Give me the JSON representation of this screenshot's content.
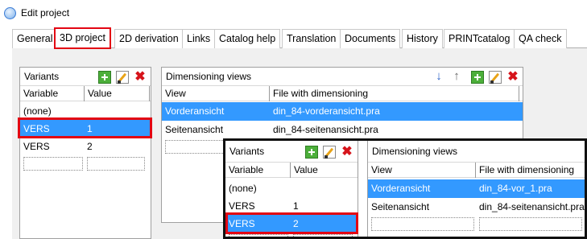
{
  "window": {
    "title": "Edit project"
  },
  "tabs": [
    {
      "label": "General"
    },
    {
      "label": "3D project"
    },
    {
      "label": "2D derivation"
    },
    {
      "label": "Links"
    },
    {
      "label": "Catalog help"
    },
    {
      "label": "Translation"
    },
    {
      "label": "Documents"
    },
    {
      "label": "History"
    },
    {
      "label": "PRINTcatalog"
    },
    {
      "label": "QA check"
    }
  ],
  "active_tab": "3D project",
  "variants": {
    "title": "Variants",
    "columns": [
      "Variable",
      "Value"
    ],
    "rows": [
      {
        "variable": "(none)",
        "value": ""
      },
      {
        "variable": "VERS",
        "value": "1"
      },
      {
        "variable": "VERS",
        "value": "2"
      }
    ],
    "selected_row": 1,
    "icons": [
      "add-icon",
      "edit-icon",
      "delete-icon"
    ]
  },
  "dimensioning_views": {
    "title": "Dimensioning views",
    "columns": [
      "View",
      "File with dimensioning"
    ],
    "rows": [
      {
        "view": "Vorderansicht",
        "file": "din_84-vorderansicht.pra"
      },
      {
        "view": "Seitenansicht",
        "file": "din_84-seitenansicht.pra"
      }
    ],
    "selected_row": 0,
    "icons": [
      "move-down-icon",
      "move-up-icon",
      "add-icon",
      "edit-icon",
      "delete-icon"
    ]
  },
  "inset": {
    "variants": {
      "title": "Variants",
      "columns": [
        "Variable",
        "Value"
      ],
      "rows": [
        {
          "variable": "(none)",
          "value": ""
        },
        {
          "variable": "VERS",
          "value": "1"
        },
        {
          "variable": "VERS",
          "value": "2"
        }
      ],
      "selected_row": 2
    },
    "dimensioning_views": {
      "title": "Dimensioning views",
      "columns": [
        "View",
        "File with dimensioning"
      ],
      "rows": [
        {
          "view": "Vorderansicht",
          "file": "din_84-vor_1.pra"
        },
        {
          "view": "Seitenansicht",
          "file": "din_84-seitenansicht.pra"
        }
      ],
      "selected_row": 0
    }
  },
  "colors": {
    "selection": "#3399ff",
    "highlight_border": "#e30613",
    "inset_border": "#111111"
  }
}
